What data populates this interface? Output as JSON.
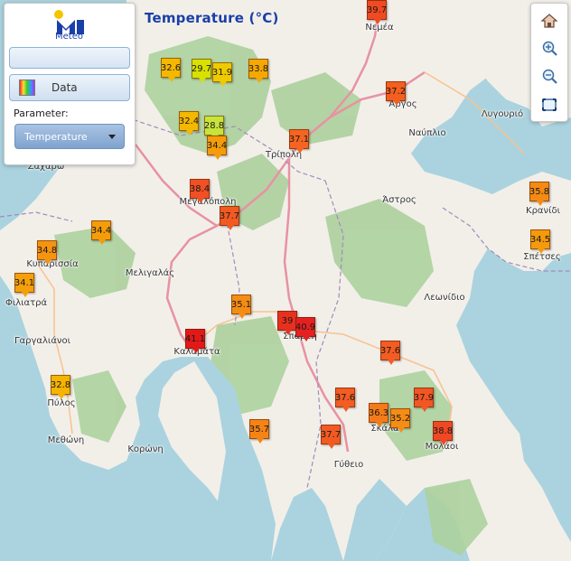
{
  "map": {
    "title": "Temperature (°C)",
    "base_colors": {
      "sea": "#aad3df",
      "land": "#f2efe9",
      "forest": "#add19e",
      "primary_road": "#e892a2",
      "border": "#a08bbb"
    }
  },
  "panel": {
    "logo_text": "Meteo",
    "search_value": "",
    "data_button_label": "Data",
    "parameter_label": "Parameter:",
    "parameter_selected": "Temperature"
  },
  "toolbar": {
    "items": [
      {
        "name": "home-icon",
        "label": "Home"
      },
      {
        "name": "zoom-in-icon",
        "label": "Zoom in"
      },
      {
        "name": "zoom-out-icon",
        "label": "Zoom out"
      },
      {
        "name": "extent-icon",
        "label": "Full extent"
      }
    ]
  },
  "places": [
    "Νεμέα",
    "Άργος",
    "Λυγουριό",
    "Ναύπλιο",
    "Τρίπολη",
    "Άστρος",
    "Μεγαλόπολη",
    "Κρανίδι",
    "Σπέτσες",
    "Ζαχάρω",
    "Κυπαρισσία",
    "Μελιγαλάς",
    "Λεωνίδιο",
    "Φιλιατρά",
    "Γαργαλιάνοι",
    "Καλαμάτα",
    "Σπάρτη",
    "Πύλος",
    "Σκάλα",
    "Μολάοι",
    "Μεθώνη",
    "Κορώνη",
    "Γύθειο"
  ],
  "stations": [
    {
      "value": "39.7",
      "color": "#f04a22"
    },
    {
      "value": "32.6",
      "color": "#f5b800"
    },
    {
      "value": "29.7",
      "color": "#d8e200"
    },
    {
      "value": "31.9",
      "color": "#eecb00"
    },
    {
      "value": "33.8",
      "color": "#f5a800"
    },
    {
      "value": "37.2",
      "color": "#f55e1e"
    },
    {
      "value": "32.4",
      "color": "#f5b800"
    },
    {
      "value": "28.8",
      "color": "#c8e43a"
    },
    {
      "value": "34.4",
      "color": "#f59c0a"
    },
    {
      "value": "37.1",
      "color": "#f56420"
    },
    {
      "value": "38.4",
      "color": "#f05024"
    },
    {
      "value": "37.7",
      "color": "#f25a22"
    },
    {
      "value": "35.8",
      "color": "#f58a14"
    },
    {
      "value": "34.4",
      "color": "#f59c0a"
    },
    {
      "value": "34.5",
      "color": "#f59a0c"
    },
    {
      "value": "34.8",
      "color": "#f59410"
    },
    {
      "value": "34.1",
      "color": "#f5a00a"
    },
    {
      "value": "35.1",
      "color": "#f58c14"
    },
    {
      "value": "39",
      "color": "#e8301e"
    },
    {
      "value": "40.9",
      "color": "#e52020"
    },
    {
      "value": "41.1",
      "color": "#e41818"
    },
    {
      "value": "37.6",
      "color": "#f35c22"
    },
    {
      "value": "32.8",
      "color": "#f5b400"
    },
    {
      "value": "37.6",
      "color": "#f35c22"
    },
    {
      "value": "37.9",
      "color": "#f25622"
    },
    {
      "value": "36.3",
      "color": "#f57a18"
    },
    {
      "value": "35.2",
      "color": "#f58c14"
    },
    {
      "value": "38.8",
      "color": "#f04824"
    },
    {
      "value": "35.7",
      "color": "#f58414"
    },
    {
      "value": "37.7",
      "color": "#f25a22"
    }
  ]
}
